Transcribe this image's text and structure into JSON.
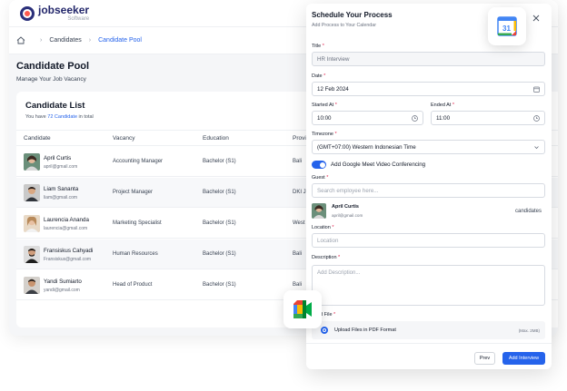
{
  "brand": {
    "name": "jobseeker",
    "tagline": "Software"
  },
  "breadcrumb": {
    "items": [
      "Candidates",
      "Candidate Pool"
    ]
  },
  "page": {
    "title": "Candidate Pool",
    "subtitle": "Manage Your Job Vacancy"
  },
  "list": {
    "title": "Candidate List",
    "count_prefix": "You have",
    "count_link": "72 Candidate",
    "count_suffix": "in total",
    "columns": [
      "Candidate",
      "Vacancy",
      "Education",
      "Provi"
    ],
    "rows": [
      {
        "name": "April Curtis",
        "email": "april@gmail.com",
        "vacancy": "Accounting Manager",
        "education": "Bachelor (S1)",
        "province": "Bali"
      },
      {
        "name": "Liam Sananta",
        "email": "liam@gmail.com",
        "vacancy": "Project Manager",
        "education": "Bachelor (S1)",
        "province": "DKI J"
      },
      {
        "name": "Laurencia Ananda",
        "email": "laurencia@gmail.com",
        "vacancy": "Marketing Specialist",
        "education": "Bachelor (S1)",
        "province": "West"
      },
      {
        "name": "Fransiskus Cahyadi",
        "email": "Fransiskus@gmail.com",
        "vacancy": "Human Resources",
        "education": "Bachelor (S1)",
        "province": "Bali"
      },
      {
        "name": "Yandi Sumiarto",
        "email": "yandi@gmail.com",
        "vacancy": "Head of Product",
        "education": "Bachelor (S1)",
        "province": "Bali"
      }
    ]
  },
  "modal": {
    "title": "Schedule Your Process",
    "subtitle": "Add Process to Your Calendar",
    "title_label": "Title",
    "title_value": "HR Interview",
    "date_label": "Date",
    "date_value": "12 Feb 2024",
    "started_label": "Started At",
    "started_value": "10:00",
    "ended_label": "Ended At",
    "ended_value": "11:00",
    "timezone_label": "Timezone",
    "timezone_value": "(GMT+07:00) Western Indonesian Time",
    "meet_toggle_label": "Add Google Meet Video Conferencing",
    "meet_toggle_on": true,
    "guest_label": "Guest",
    "guest_placeholder": "Search employee here...",
    "guest": {
      "name": "April Curtis",
      "email": "april@gmail.com",
      "role": "candidates"
    },
    "location_label": "Location",
    "location_placeholder": "Location",
    "description_label": "Description",
    "description_placeholder": "Add Description...",
    "upload_label": "Upload File",
    "upload_label_visible": "ad File",
    "upload_option": "Upload Files in PDF Format",
    "upload_limit": "(Max. 2MB)",
    "prev_button": "Prev",
    "add_button": "Add Interview",
    "required_mark": "*"
  },
  "calendar_icon": {
    "day": "31"
  },
  "colors": {
    "accent": "#2563eb",
    "required": "#e11d48",
    "brand": "#23276b"
  }
}
